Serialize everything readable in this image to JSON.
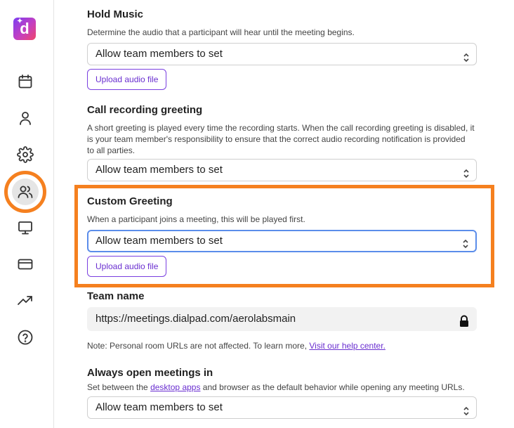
{
  "app": {
    "logo_letter": "d"
  },
  "sidebar": {
    "items": [
      {
        "name": "calendar",
        "icon": "calendar-icon"
      },
      {
        "name": "profile",
        "icon": "user-icon"
      },
      {
        "name": "settings",
        "icon": "gear-icon"
      },
      {
        "name": "team",
        "icon": "users-icon",
        "active": true
      },
      {
        "name": "display",
        "icon": "monitor-icon"
      },
      {
        "name": "billing",
        "icon": "credit-card-icon"
      },
      {
        "name": "analytics",
        "icon": "trending-up-icon"
      },
      {
        "name": "help",
        "icon": "question-circle-icon"
      }
    ]
  },
  "hold_music": {
    "title": "Hold Music",
    "description": "Determine the audio that a participant will hear until the meeting begins.",
    "select_value": "Allow team members to set",
    "upload_label": "Upload audio file"
  },
  "call_recording": {
    "title": "Call recording greeting",
    "description_line1": "A short greeting is played every time the recording starts. When the call recording greeting is disabled, it",
    "description_line2": "is your team member's responsibility to ensure that the correct audio recording notification is provided",
    "description_line3": "to all parties.",
    "select_value": "Allow team members to set"
  },
  "custom_greeting": {
    "title": "Custom Greeting",
    "description": "When a participant joins a meeting, this will be played first.",
    "select_value": "Allow team members to set",
    "upload_label": "Upload audio file"
  },
  "team_name": {
    "title": "Team name",
    "url": "https://meetings.dialpad.com/aerolabsmain",
    "note_prefix": "Note: Personal room URLs are not affected. To learn more, ",
    "note_link": "Visit our help center."
  },
  "always_open": {
    "title": "Always open meetings in",
    "desc_prefix": "Set between the ",
    "desc_link": "desktop apps",
    "desc_suffix": " and browser as the default behavior while opening any meeting URLs.",
    "select_value": "Allow team members to set"
  },
  "colors": {
    "accent": "#6a2fd0",
    "highlight": "#f5801f",
    "focus": "#5b8dea"
  }
}
